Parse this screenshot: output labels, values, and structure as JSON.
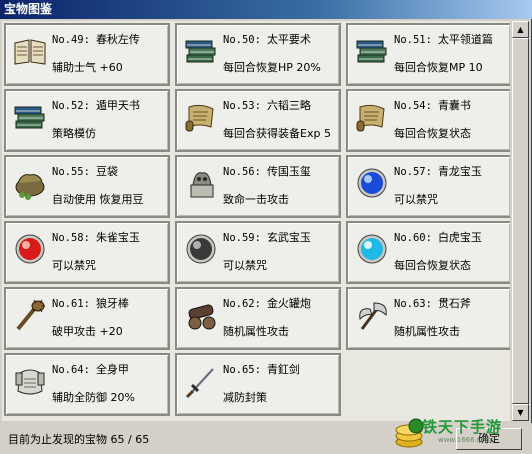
{
  "window": {
    "title": "宝物图鉴"
  },
  "items": [
    {
      "no": "No.49:",
      "name": "春秋左传",
      "desc": "辅助士气 +60",
      "icon": "book-icon"
    },
    {
      "no": "No.50:",
      "name": "太平要术",
      "desc": "每回合恢复HP 20%",
      "icon": "book-stack-icon"
    },
    {
      "no": "No.51:",
      "name": "太平领道篇",
      "desc": "每回合恢复MP 10",
      "icon": "book-stack-icon"
    },
    {
      "no": "No.52:",
      "name": "遁甲天书",
      "desc": "策略模仿",
      "icon": "book-stack-icon"
    },
    {
      "no": "No.53:",
      "name": "六韬三略",
      "desc": "每回合获得装备Exp 5",
      "icon": "scroll-icon"
    },
    {
      "no": "No.54:",
      "name": "青囊书",
      "desc": "每回合恢复状态",
      "icon": "scroll-icon"
    },
    {
      "no": "No.55:",
      "name": "豆袋",
      "desc": "自动使用 恢复用豆",
      "icon": "bean-bag-icon"
    },
    {
      "no": "No.56:",
      "name": "传国玉玺",
      "desc": "致命一击攻击",
      "icon": "jade-seal-icon"
    },
    {
      "no": "No.57:",
      "name": "青龙宝玉",
      "desc": "可以禁咒",
      "icon": "blue-orb-icon"
    },
    {
      "no": "No.58:",
      "name": "朱雀宝玉",
      "desc": "可以禁咒",
      "icon": "red-orb-icon"
    },
    {
      "no": "No.59:",
      "name": "玄武宝玉",
      "desc": "可以禁咒",
      "icon": "black-orb-icon"
    },
    {
      "no": "No.60:",
      "name": "白虎宝玉",
      "desc": "每回合恢复状态",
      "icon": "cyan-orb-icon"
    },
    {
      "no": "No.61:",
      "name": "狼牙棒",
      "desc": "破甲攻击 +20",
      "icon": "spiked-club-icon"
    },
    {
      "no": "No.62:",
      "name": "金火罐炮",
      "desc": "随机属性攻击",
      "icon": "cannon-icon"
    },
    {
      "no": "No.63:",
      "name": "贯石斧",
      "desc": "随机属性攻击",
      "icon": "axe-icon"
    },
    {
      "no": "No.64:",
      "name": "全身甲",
      "desc": "辅助全防御 20%",
      "icon": "armor-icon"
    },
    {
      "no": "No.65:",
      "name": "青釭剑",
      "desc": "减防封策",
      "icon": "sword-icon"
    }
  ],
  "status": {
    "text": "目前为止发现的宝物 65 / 65"
  },
  "ok_button": {
    "label": "确定"
  },
  "watermark": {
    "text": "铁天下手游",
    "sub": "www.1666.com"
  },
  "colors": {
    "titlebar_start": "#0a246a",
    "card_bg": "#eeeeea",
    "watermark_green": "#1f9a3a"
  }
}
